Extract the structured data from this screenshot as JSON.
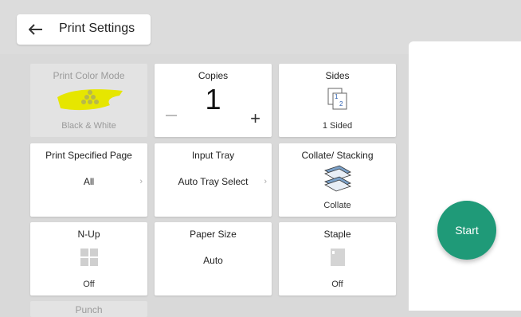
{
  "header": {
    "title": "Print Settings",
    "back_icon": "arrow-left-icon"
  },
  "tiles": {
    "color_mode": {
      "label": "Print Color Mode",
      "value": "Black & White",
      "disabled": true
    },
    "copies": {
      "label": "Copies",
      "value": "1"
    },
    "sides": {
      "label": "Sides",
      "value": "1 Sided"
    },
    "specified_page": {
      "label": "Print Specified Page",
      "value": "All"
    },
    "input_tray": {
      "label": "Input Tray",
      "value": "Auto Tray Select"
    },
    "collate": {
      "label": "Collate/ Stacking",
      "value": "Collate"
    },
    "nup": {
      "label": "N-Up",
      "value": "Off"
    },
    "paper_size": {
      "label": "Paper Size",
      "value": "Auto"
    },
    "staple": {
      "label": "Staple",
      "value": "Off"
    },
    "punch": {
      "label": "Punch",
      "disabled": true
    }
  },
  "actions": {
    "start_label": "Start"
  },
  "colors": {
    "accent": "#1f9a78",
    "highlight": "#e6e600"
  }
}
